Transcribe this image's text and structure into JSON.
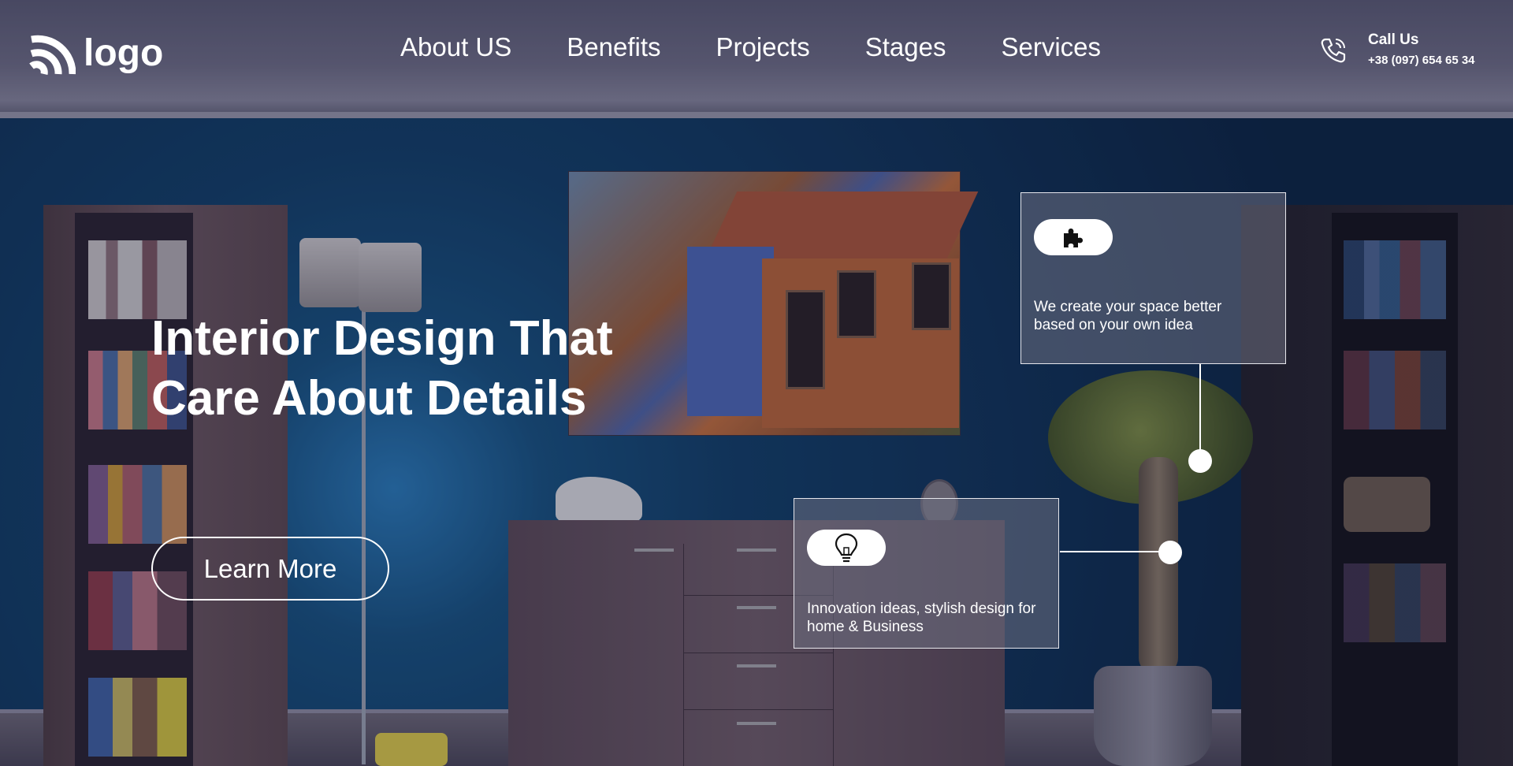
{
  "header": {
    "logo_text": "logo",
    "nav": [
      "About US",
      "Benefits",
      "Projects",
      "Stages",
      "Services"
    ],
    "call_label": "Call Us",
    "call_number": "+38 (097) 654 65 34"
  },
  "hero": {
    "title_line1": "Interior Design That",
    "title_line2": "Care About Details",
    "button_label": "Learn More"
  },
  "callouts": [
    {
      "icon": "puzzle-icon",
      "text": "We create your space better based on your own idea"
    },
    {
      "icon": "lightbulb-icon",
      "text": "Innovation ideas, stylish design for home & Business"
    }
  ],
  "colors": {
    "text": "#ffffff",
    "wall": "#123e68",
    "card_bg": "rgba(110,112,130,0.55)"
  }
}
